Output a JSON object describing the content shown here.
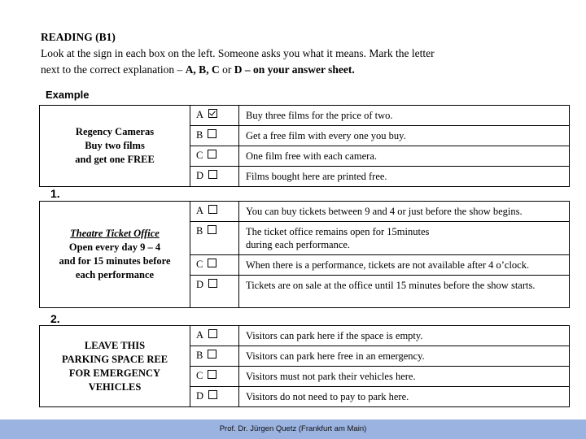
{
  "header": {
    "title": "READING (B1)",
    "instructions_line1": "Look at the sign in each box on the left. Someone asks you what it means. Mark the letter",
    "instructions_line2_prefix": "next to the correct explanation – ",
    "instructions_line2_bold1": "A, B, C",
    "instructions_line2_or": " or ",
    "instructions_line2_bold2": "D – on your answer sheet."
  },
  "questions": [
    {
      "label": "Example",
      "sign_lines": [
        "Regency Cameras",
        "Buy two films",
        "and get one FREE"
      ],
      "options": [
        {
          "letter": "A",
          "checked": true,
          "text": "Buy three films for the price of two."
        },
        {
          "letter": "B",
          "checked": false,
          "text": "Get a free film with every one you buy."
        },
        {
          "letter": "C",
          "checked": false,
          "text": "One film free with each camera."
        },
        {
          "letter": "D",
          "checked": false,
          "text": "Films bought here are printed free."
        }
      ]
    },
    {
      "label": "1.",
      "sign_title": "Theatre Ticket Office",
      "sign_lines": [
        "Open every day 9 – 4",
        "and for 15 minutes before",
        "each performance"
      ],
      "options": [
        {
          "letter": "A",
          "checked": false,
          "text": "You can buy tickets between 9 and 4 or just before the show begins."
        },
        {
          "letter": "B",
          "checked": false,
          "text": "The ticket office remains open for 15minutes during each performance."
        },
        {
          "letter": "C",
          "checked": false,
          "text": "When there is a performance, tickets are not available after 4 o’clock."
        },
        {
          "letter": "D",
          "checked": false,
          "text": "Tickets are on sale at the office until 15 minutes before the show starts."
        }
      ]
    },
    {
      "label": "2.",
      "sign_lines": [
        "LEAVE THIS",
        "PARKING SPACE REE",
        "FOR EMERGENCY",
        "VEHICLES"
      ],
      "options": [
        {
          "letter": "A",
          "checked": false,
          "text": "Visitors can park here if the space is empty."
        },
        {
          "letter": "B",
          "checked": false,
          "text": "Visitors can park here free in an emergency."
        },
        {
          "letter": "C",
          "checked": false,
          "text": "Visitors must not park their vehicles here."
        },
        {
          "letter": "D",
          "checked": false,
          "text": "Visitors do not need to pay to park here."
        }
      ]
    }
  ],
  "footer": {
    "text": "Prof. Dr. Jürgen Quetz (Frankfurt am Main)"
  },
  "colors": {
    "footer_bg": "#9bb3e0"
  }
}
